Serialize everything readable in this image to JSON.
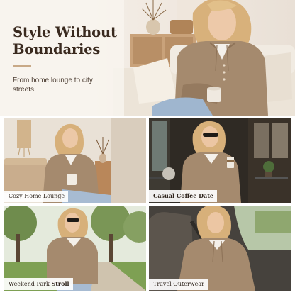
{
  "hero": {
    "title": "Style Without Boundaries",
    "subtitle": "From home lounge to city streets."
  },
  "panels": [
    {
      "caption": "Cozy Home Lounge",
      "scene": "living-room"
    },
    {
      "caption": "Casual Coffee Date",
      "scene": "cafe-terrace"
    },
    {
      "caption_plain": "Weekend Park ",
      "caption_bold": "Stroll",
      "scene": "park-path"
    },
    {
      "caption": "Travel Outerwear",
      "scene": "car-seat"
    }
  ],
  "colors": {
    "sweater": "#a58a6e",
    "background_cream": "#f3ece4",
    "title": "#3a2a1f",
    "accent_rule": "#c8a987"
  }
}
